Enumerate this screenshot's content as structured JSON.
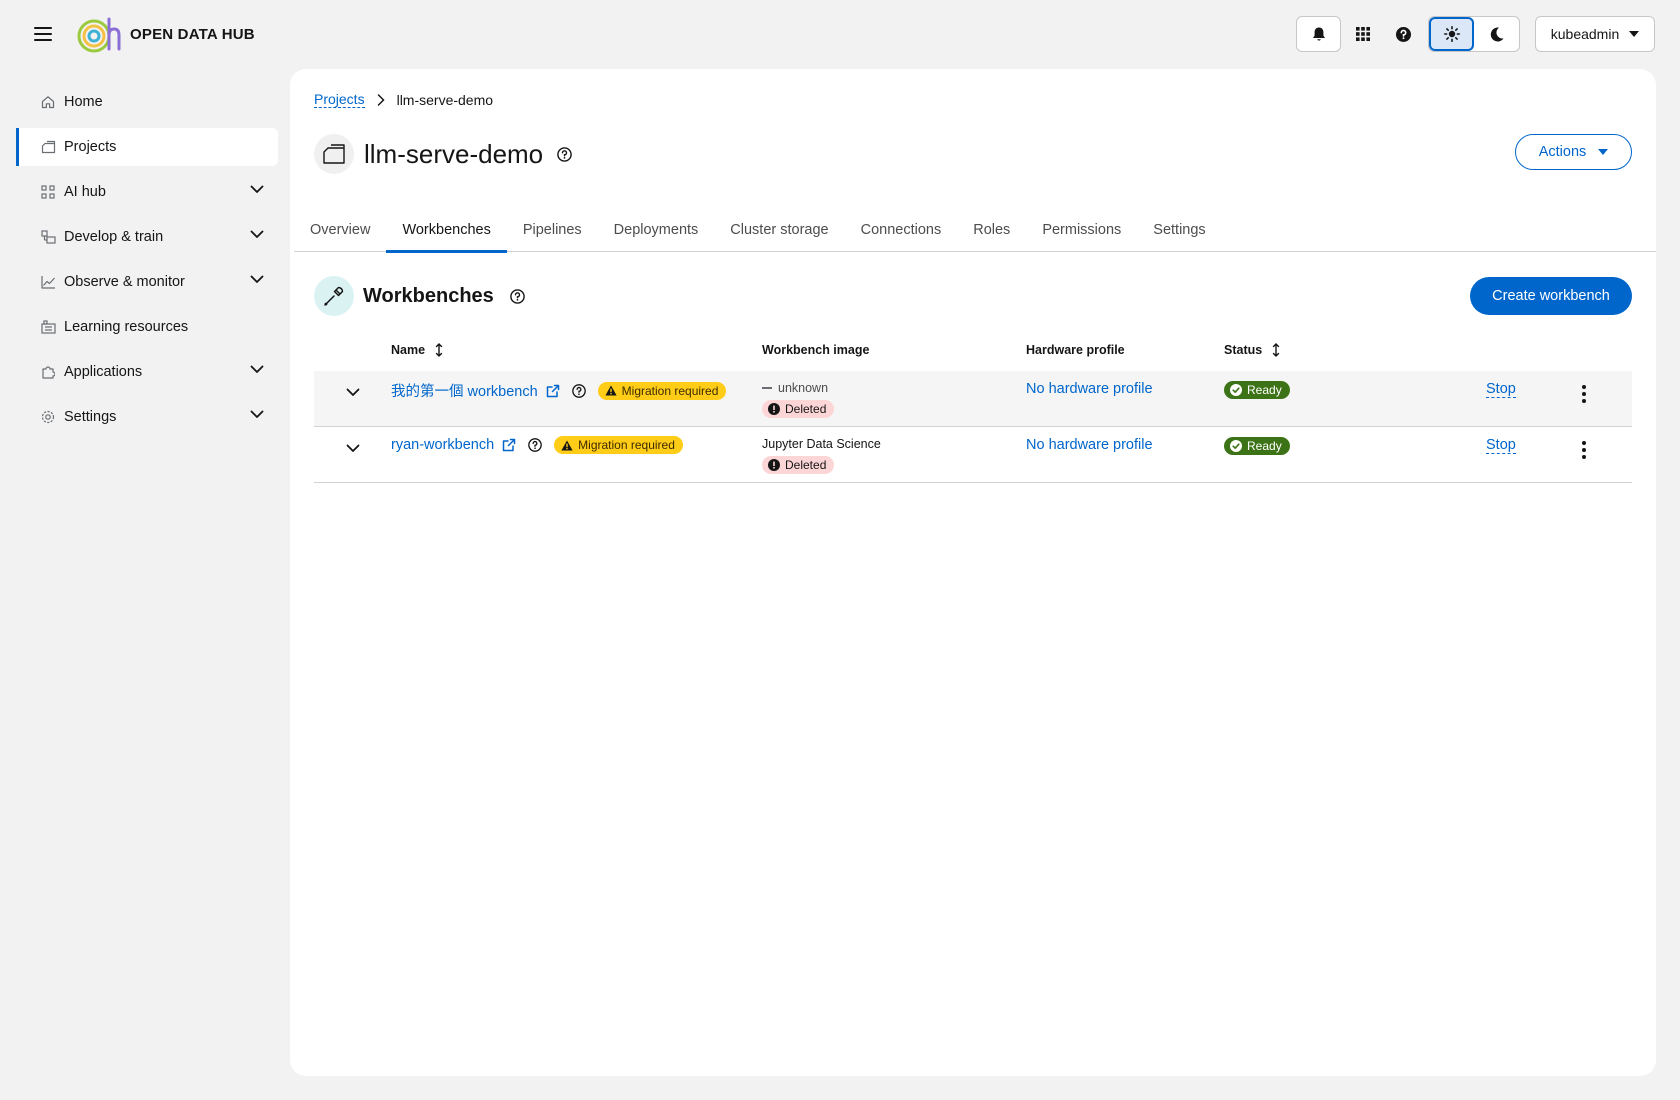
{
  "masthead": {
    "logo_text": "OPEN DATA HUB",
    "user": "kubeadmin"
  },
  "sidebar": {
    "items": [
      {
        "label": "Home",
        "icon": "home-icon",
        "expandable": false,
        "active": false
      },
      {
        "label": "Projects",
        "icon": "projects-icon",
        "expandable": false,
        "active": true
      },
      {
        "label": "AI hub",
        "icon": "ai-hub-icon",
        "expandable": true,
        "active": false
      },
      {
        "label": "Develop & train",
        "icon": "develop-icon",
        "expandable": true,
        "active": false
      },
      {
        "label": "Observe & monitor",
        "icon": "chart-line-icon",
        "expandable": true,
        "active": false
      },
      {
        "label": "Learning resources",
        "icon": "learning-icon",
        "expandable": false,
        "active": false
      },
      {
        "label": "Applications",
        "icon": "puzzle-icon",
        "expandable": true,
        "active": false
      },
      {
        "label": "Settings",
        "icon": "gear-icon",
        "expandable": true,
        "active": false
      }
    ]
  },
  "breadcrumb": {
    "parent": "Projects",
    "current": "llm-serve-demo"
  },
  "page": {
    "title": "llm-serve-demo",
    "actions_label": "Actions"
  },
  "tabs": [
    {
      "label": "Overview",
      "active": false
    },
    {
      "label": "Workbenches",
      "active": true
    },
    {
      "label": "Pipelines",
      "active": false
    },
    {
      "label": "Deployments",
      "active": false
    },
    {
      "label": "Cluster storage",
      "active": false
    },
    {
      "label": "Connections",
      "active": false
    },
    {
      "label": "Roles",
      "active": false
    },
    {
      "label": "Permissions",
      "active": false
    },
    {
      "label": "Settings",
      "active": false
    }
  ],
  "section": {
    "title": "Workbenches",
    "create_label": "Create workbench"
  },
  "table": {
    "columns": {
      "name": "Name",
      "image": "Workbench image",
      "hardware": "Hardware profile",
      "status": "Status"
    },
    "rows": [
      {
        "name": "我的第一個 workbench",
        "badge": "Migration required",
        "image": "unknown",
        "image_unknown": true,
        "image_badge": "Deleted",
        "hardware": "No hardware profile",
        "status": "Ready",
        "action": "Stop"
      },
      {
        "name": "ryan-workbench",
        "badge": "Migration required",
        "image": "Jupyter Data Science",
        "image_unknown": false,
        "image_badge": "Deleted",
        "hardware": "No hardware profile",
        "status": "Ready",
        "action": "Stop"
      }
    ]
  },
  "colors": {
    "primary": "#0066cc",
    "warning": "#ffcc17",
    "success": "#3d7317",
    "danger_bg": "#fcd6d6"
  }
}
